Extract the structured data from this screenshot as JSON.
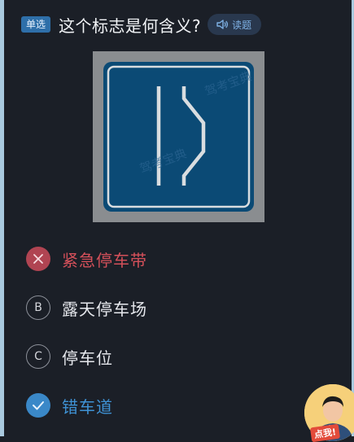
{
  "question": {
    "type_badge": "单选",
    "text": "这个标志是何含义?",
    "read_button_label": "读题"
  },
  "sign": {
    "description_icon": "lane-merge-sign-icon",
    "watermark": "驾考宝典"
  },
  "options": [
    {
      "marker": "✕",
      "label": "紧急停车带",
      "state": "wrong"
    },
    {
      "marker": "B",
      "label": "露天停车场",
      "state": "unselected"
    },
    {
      "marker": "C",
      "label": "停车位",
      "state": "unselected"
    },
    {
      "marker": "✓",
      "label": "错车道",
      "state": "correct"
    }
  ],
  "avatar": {
    "tag_text": "点我!"
  },
  "colors": {
    "background": "#1b1f27",
    "wrong": "#d4505a",
    "correct": "#3f93d6",
    "sign_blue": "#0b4a75"
  }
}
